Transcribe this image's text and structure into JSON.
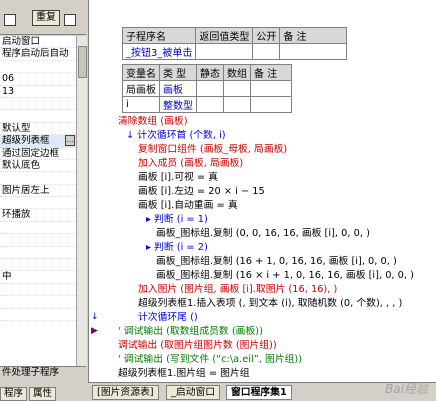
{
  "toolbar": {
    "button_label": "重复"
  },
  "props": [
    "启动窗口",
    "程序启动后自动",
    "",
    "06",
    "13",
    "",
    "",
    "默认型",
    "超级列表框",
    "通过固定边框",
    "默认底色",
    "",
    "图片居左上",
    "",
    "环播放",
    "",
    "",
    "",
    "",
    "中",
    "",
    "",
    "",
    "件处理子程序"
  ],
  "left_tabs": [
    "程序",
    "属性"
  ],
  "sub_table": {
    "headers": [
      "子程序名",
      "返回值类型",
      "公开",
      "备 注"
    ],
    "name": "_按钮3_被单击"
  },
  "var_table": {
    "headers": [
      "变量名",
      "类 型",
      "静态",
      "数组",
      "备 注"
    ],
    "rows": [
      [
        "局画板",
        "画板"
      ],
      [
        "i",
        "整数型"
      ]
    ]
  },
  "code": [
    "清除数组 (画板)",
    "计次循环首 (个数, i)",
    "复制窗口组件 (画板_母板, 局画板)",
    "加入成员 (画板, 局画板)",
    "画板 [i].可视 = 真",
    "画板 [i].左边 = 20 × i − 15",
    "画板 [i].自动重画 = 真",
    "判断 (i = 1)",
    "画板_图标组.复制 (0, 0, 16, 16, 画板 [i], 0, 0, )",
    "判断 (i = 2)",
    "画板_图标组.复制 (16 + 1, 0, 16, 16, 画板 [i], 0, 0, )",
    "画板_图标组.复制 (16 × i + 1, 0, 16, 16, 画板 [i], 0, 0, )",
    "加入图片 (图片组, 画板 [i].取图片 (16, 16), )",
    "超级列表框1.插入表项 (, 到文本 (i), 取随机数 (0, 个数), , , )",
    "计次循环尾 ()",
    "' 调试输出 (取数组成员数 (画板))",
    "调试输出 (取图片组图片数 (图片组))",
    "' 调试输出 (写到文件 (“c:\\a.eil”, 图片组))",
    "超级列表框1.图片组 = 图片组"
  ],
  "bottom_tabs": [
    "[图片资源表]",
    "_启动窗口",
    "窗口程序集1"
  ],
  "watermark": "Bai经验"
}
